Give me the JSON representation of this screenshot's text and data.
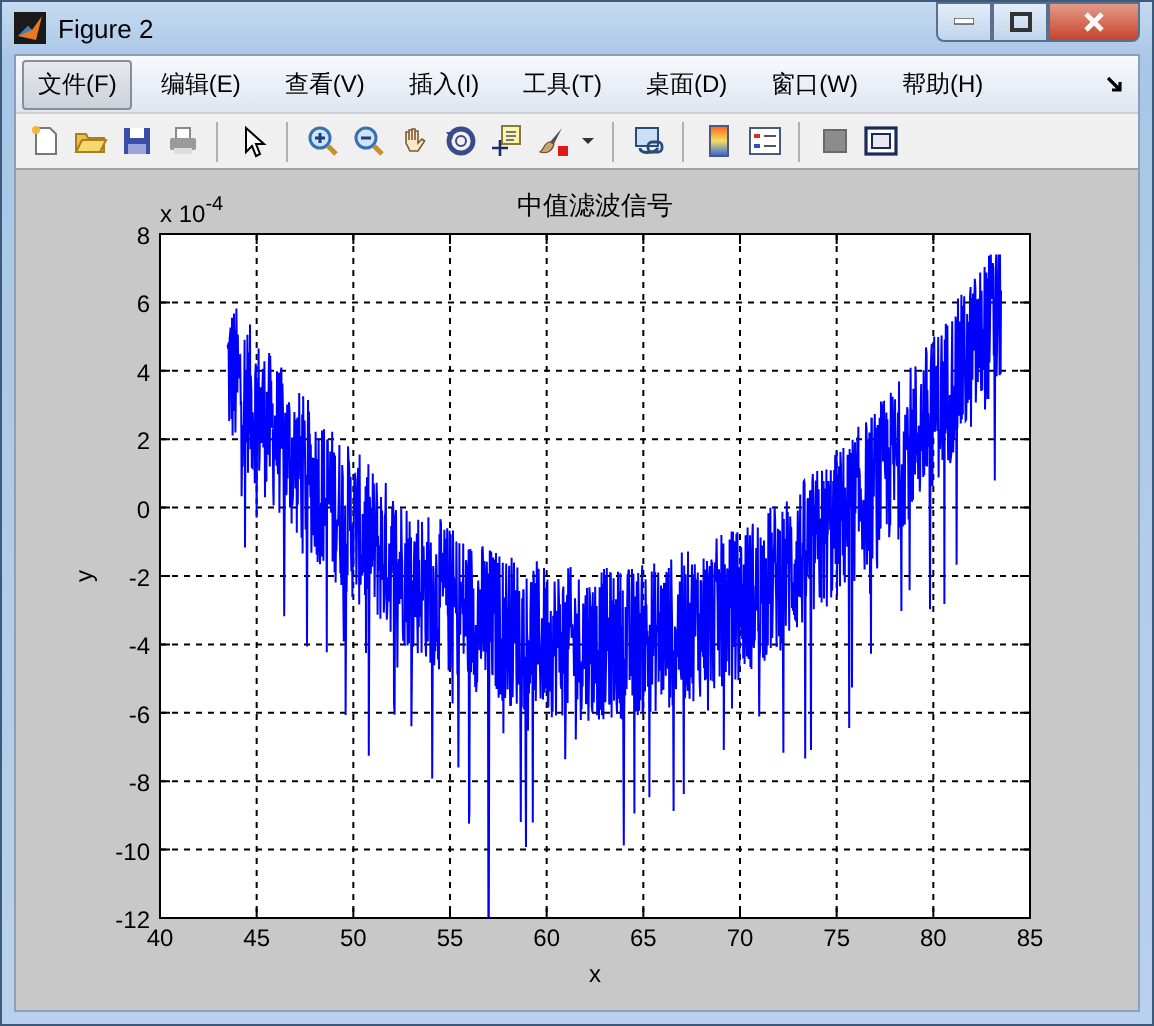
{
  "window": {
    "title": "Figure 2"
  },
  "menu": [
    {
      "label": "文件(F)",
      "selected": true
    },
    {
      "label": "编辑(E)",
      "selected": false
    },
    {
      "label": "查看(V)",
      "selected": false
    },
    {
      "label": "插入(I)",
      "selected": false
    },
    {
      "label": "工具(T)",
      "selected": false
    },
    {
      "label": "桌面(D)",
      "selected": false
    },
    {
      "label": "窗口(W)",
      "selected": false
    },
    {
      "label": "帮助(H)",
      "selected": false
    }
  ],
  "plot": {
    "title": "中值滤波信号",
    "xlabel": "x",
    "ylabel": "y",
    "exponent": "x 10$^{-4}$",
    "xticks": [
      "40",
      "45",
      "50",
      "55",
      "60",
      "65",
      "70",
      "75",
      "80",
      "85"
    ],
    "yticks": [
      "8",
      "6",
      "4",
      "2",
      "0",
      "-2",
      "-4",
      "-6",
      "-8",
      "-10",
      "-12"
    ]
  }
}
